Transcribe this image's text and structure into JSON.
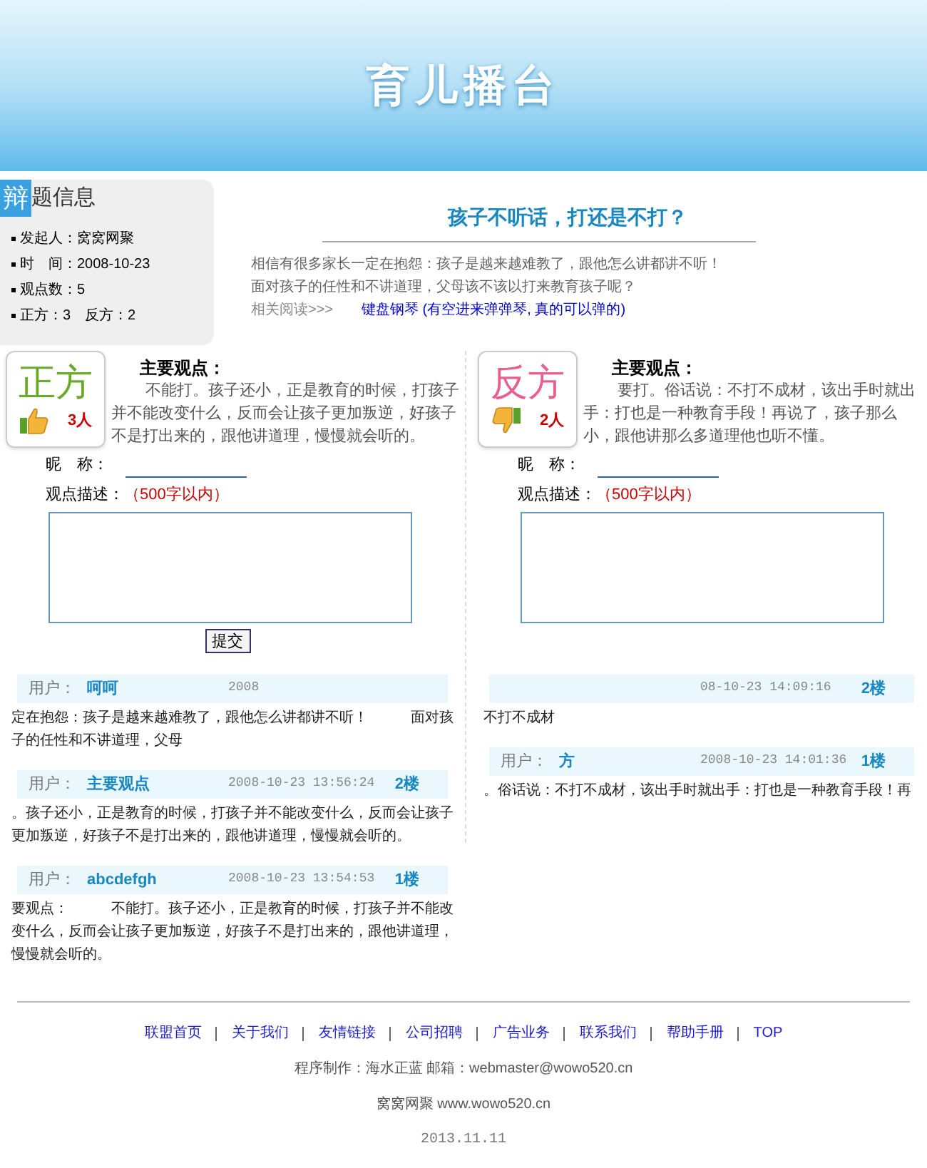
{
  "banner": {
    "title": "育儿播台"
  },
  "topic_info": {
    "badge": "辩",
    "title": "题信息",
    "items": [
      "发起人：窝窝网聚",
      "时　间：2008-10-23",
      "观点数：5",
      "正方：3　反方：2"
    ]
  },
  "topic": {
    "title": "孩子不听话，打还是不打？",
    "description": [
      "相信有很多家长一定在抱怨：孩子是越来越难教了，跟他怎么讲都讲不听！",
      "面对孩子的任性和不讲道理，父母该不该以打来教育孩子呢？"
    ],
    "related_label": "相关阅读>>>",
    "related_link": "键盘钢琴 (有空进来弹弹琴, 真的可以弹的)"
  },
  "sides": [
    {
      "kind": "pro",
      "label": "正方",
      "count": "3人",
      "heading": "主要观点：",
      "text": "不能打。孩子还小，正是教育的时候，打孩子并不能改变什么，反而会让孩子更加叛逆，好孩子不是打出来的，跟他讲道理，慢慢就会听的。",
      "nickname_label": "昵　称：",
      "desc_label": "观点描述：",
      "desc_limit": "（500字以内）",
      "submit": "提交",
      "comments": [
        {
          "user_label": "用户：",
          "user": "呵呵",
          "date": "2008",
          "body": "定在抱怨：孩子是越来越难教了，跟他怎么讲都讲不听！　　　面对孩子的任性和不讲道理，父母"
        },
        {
          "user_label": "用户：",
          "user": "主要观点",
          "date": "2008-10-23 13:56:24",
          "floor": "2楼",
          "body": "。孩子还小，正是教育的时候，打孩子并不能改变什么，反而会让孩子更加叛逆，好孩子不是打出来的，跟他讲道理，慢慢就会听的。"
        },
        {
          "user_label": "用户：",
          "user": "abcdefgh",
          "date": "2008-10-23 13:54:53",
          "floor": "1楼",
          "body": "要观点：　　　不能打。孩子还小，正是教育的时候，打孩子并不能改变什么，反而会让孩子更加叛逆，好孩子不是打出来的，跟他讲道理，慢慢就会听的。"
        }
      ]
    },
    {
      "kind": "con",
      "label": "反方",
      "count": "2人",
      "heading": "主要观点：",
      "text": "要打。俗话说：不打不成材，该出手时就出手：打也是一种教育手段！再说了，孩子那么小，跟他讲那么多道理他也听不懂。",
      "nickname_label": "昵　称：",
      "desc_label": "观点描述：",
      "desc_limit": "（500字以内）",
      "comments": [
        {
          "date": "08-10-23 14:09:16",
          "floor": "2楼",
          "body": "不打不成材"
        },
        {
          "user_label": "用户：",
          "user": "方",
          "date": "2008-10-23 14:01:36",
          "floor": "1楼",
          "body": "。俗话说：不打不成材，该出手时就出手：打也是一种教育手段！再"
        }
      ]
    }
  ],
  "footer": {
    "links": [
      "联盟首页",
      "关于我们",
      "友情链接",
      "公司招聘",
      "广告业务",
      "联系我们",
      "帮助手册",
      "TOP"
    ],
    "credit": "程序制作：海水正蓝 邮箱：webmaster@wowo520.cn",
    "site": "窝窝网聚 www.wowo520.cn",
    "date": "2013.11.11"
  }
}
